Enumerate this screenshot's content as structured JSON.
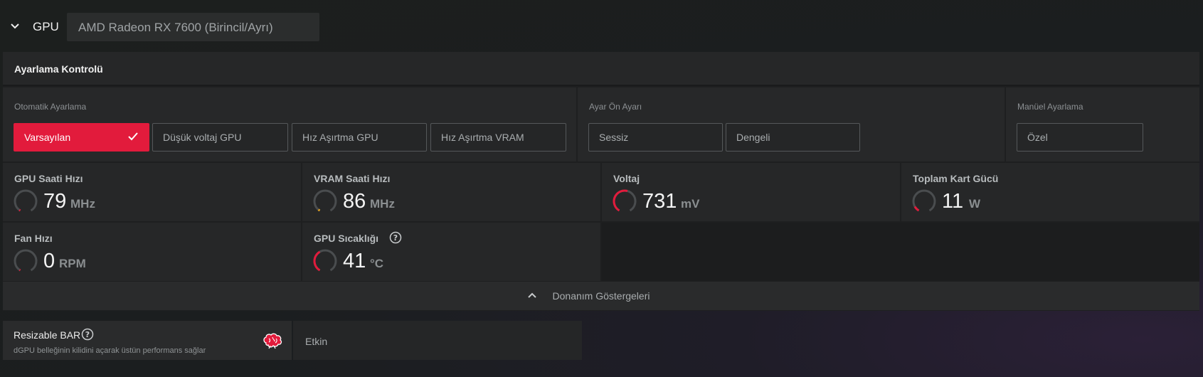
{
  "header": {
    "section_label": "GPU",
    "gpu_name": "AMD Radeon RX 7600 (Birincil/Ayrı)"
  },
  "tuning": {
    "title": "Ayarlama Kontrolü",
    "auto": {
      "label": "Otomatik Ayarlama",
      "options": [
        "Varsayılan",
        "Düşük voltaj GPU",
        "Hız Aşırtma GPU",
        "Hız Aşırtma VRAM"
      ],
      "selected": "Varsayılan"
    },
    "preset": {
      "label": "Ayar Ön Ayarı",
      "options": [
        "Sessiz",
        "Dengeli"
      ]
    },
    "manual": {
      "label": "Manüel Ayarlama",
      "options": [
        "Özel"
      ]
    }
  },
  "metrics": [
    {
      "label": "GPU Saati Hızı",
      "value": "79",
      "unit": "MHz",
      "level": 0.02
    },
    {
      "label": "VRAM Saati Hızı",
      "value": "86",
      "unit": "MHz",
      "level": 0.03
    },
    {
      "label": "Voltaj",
      "value": "731",
      "unit": "mV",
      "level": 0.55
    },
    {
      "label": "Toplam Kart Gücü",
      "value": "11",
      "unit": "W",
      "level": 0.1
    },
    {
      "label": "Fan Hızı",
      "value": "0",
      "unit": "RPM",
      "level": 0
    },
    {
      "label": "GPU Sıcaklığı",
      "value": "41",
      "unit": "°C",
      "level": 0.4
    }
  ],
  "hardware_indicators_label": "Donanım Göstergeleri",
  "resizable_bar": {
    "title": "Resizable BAR",
    "subtitle": "dGPU belleğinin kilidini açarak üstün performans sağlar",
    "value": "Etkin"
  },
  "colors": {
    "accent": "#e21b3c",
    "gauge_track": "#4a4d4f",
    "vram_tick": "#e0a020"
  },
  "icons": {
    "collapse": "chevron-down-icon",
    "help": "question-circle-icon",
    "check": "checkmark-icon",
    "expand": "chevron-up-icon",
    "brain": "brain-icon"
  }
}
